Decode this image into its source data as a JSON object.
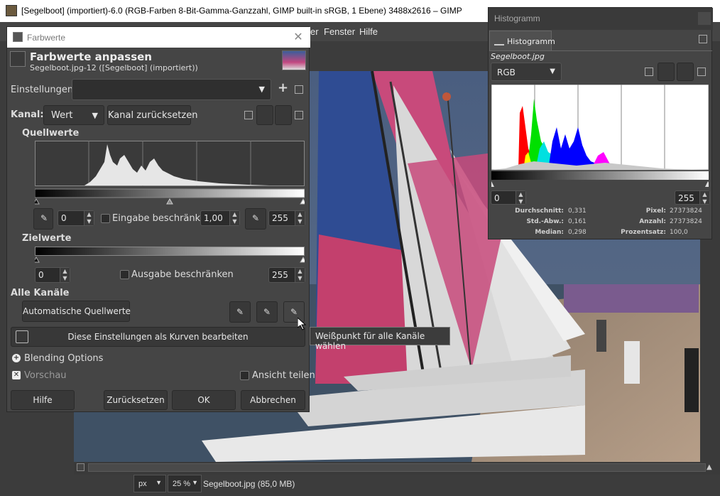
{
  "window": {
    "title": "[Segelboot] (importiert)-6.0 (RGB-Farben 8-Bit-Gamma-Ganzzahl, GIMP built-in sRGB, 1 Ebene) 3488x2616 – GIMP"
  },
  "menubar": {
    "items": [
      "er",
      "Fenster",
      "Hilfe"
    ]
  },
  "statusbar": {
    "unit": "px",
    "zoom": "25 %",
    "file_info": "Segelboot.jpg (85,0 MB)"
  },
  "dialog": {
    "window_title": "Farbwerte",
    "title": "Farbwerte anpassen",
    "subtitle": "Segelboot.jpg-12 ([Segelboot] (importiert))",
    "settings_label": "Einstellungen:",
    "settings_value": "",
    "channel_label": "Kanal:",
    "channel_value": "Wert",
    "reset_channel": "Kanal zurücksetzen",
    "input_heading": "Quellwerte",
    "input_low": "0",
    "input_gamma": "1,00",
    "input_high": "255",
    "clamp_input": "Eingabe beschränken",
    "output_heading": "Zielwerte",
    "output_low": "0",
    "output_high": "255",
    "clamp_output": "Ausgabe beschränken",
    "all_channels_heading": "Alle Kanäle",
    "auto_input": "Automatische Quellwerte",
    "edit_as_curves": "Diese Einstellungen als Kurven bearbeiten",
    "blending_options": "Blending Options",
    "preview": "Vorschau",
    "split_view": "Ansicht teilen",
    "buttons": {
      "help": "Hilfe",
      "reset": "Zurücksetzen",
      "ok": "OK",
      "cancel": "Abbrechen"
    },
    "tooltip": "Weißpunkt für alle Kanäle wählen"
  },
  "histogram": {
    "window_title": "Histogramm",
    "tab_label": "Histogramm",
    "image_name": "Segelboot.jpg",
    "channel": "RGB",
    "range_low": "0",
    "range_high": "255",
    "stats": {
      "mean_label": "Durchschnitt:",
      "mean": "0,331",
      "std_label": "Std.-Abw.:",
      "std": "0,161",
      "median_label": "Median:",
      "median": "0,298",
      "pixels_label": "Pixel:",
      "pixels": "27373824",
      "count_label": "Anzahl:",
      "count": "27373824",
      "percentile_label": "Prozentsatz:",
      "percentile": "100,0"
    }
  },
  "colors": {
    "accent": "#454545",
    "red": "#ff0000",
    "green": "#00ff00",
    "blue": "#0000ff"
  }
}
